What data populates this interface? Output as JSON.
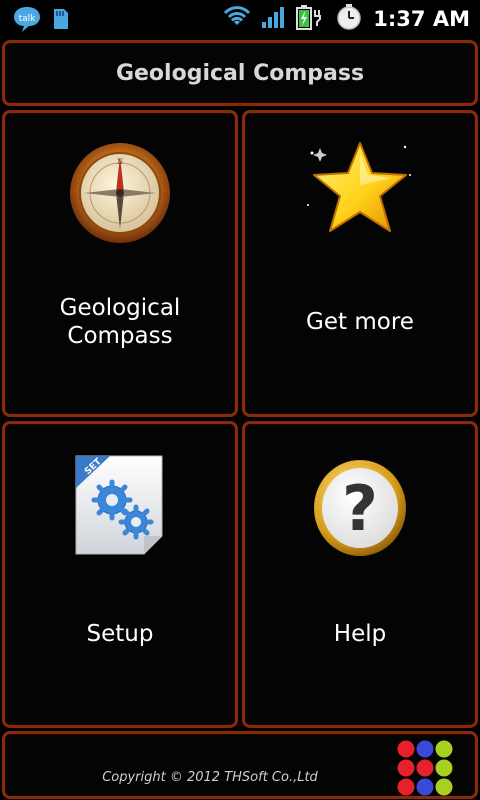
{
  "status_bar": {
    "time": "1:37 AM",
    "talk_label": "talk",
    "icons": [
      "talk-icon",
      "sd-card-icon",
      "wifi-icon",
      "signal-icon",
      "battery-charging-icon",
      "alarm-icon"
    ]
  },
  "header": {
    "title": "Geological Compass"
  },
  "tiles": [
    {
      "label_line1": "Geological",
      "label_line2": "Compass",
      "icon": "compass-icon"
    },
    {
      "label_line1": "Get more",
      "icon": "star-icon"
    },
    {
      "label_line1": "Setup",
      "icon": "settings-file-icon",
      "badge": "SET"
    },
    {
      "label_line1": "Help",
      "icon": "help-icon",
      "glyph": "?"
    }
  ],
  "footer": {
    "copyright": "Copyright © 2012 THSoft Co.,Ltd",
    "dot_colors": [
      "#e8202a",
      "#3a4ad8",
      "#a8d020",
      "#e8202a",
      "#e8202a",
      "#a8d020",
      "#e8202a",
      "#3a4ad8",
      "#a8d020"
    ]
  },
  "colors": {
    "frame": "#8a2a0c",
    "background": "#000000"
  }
}
